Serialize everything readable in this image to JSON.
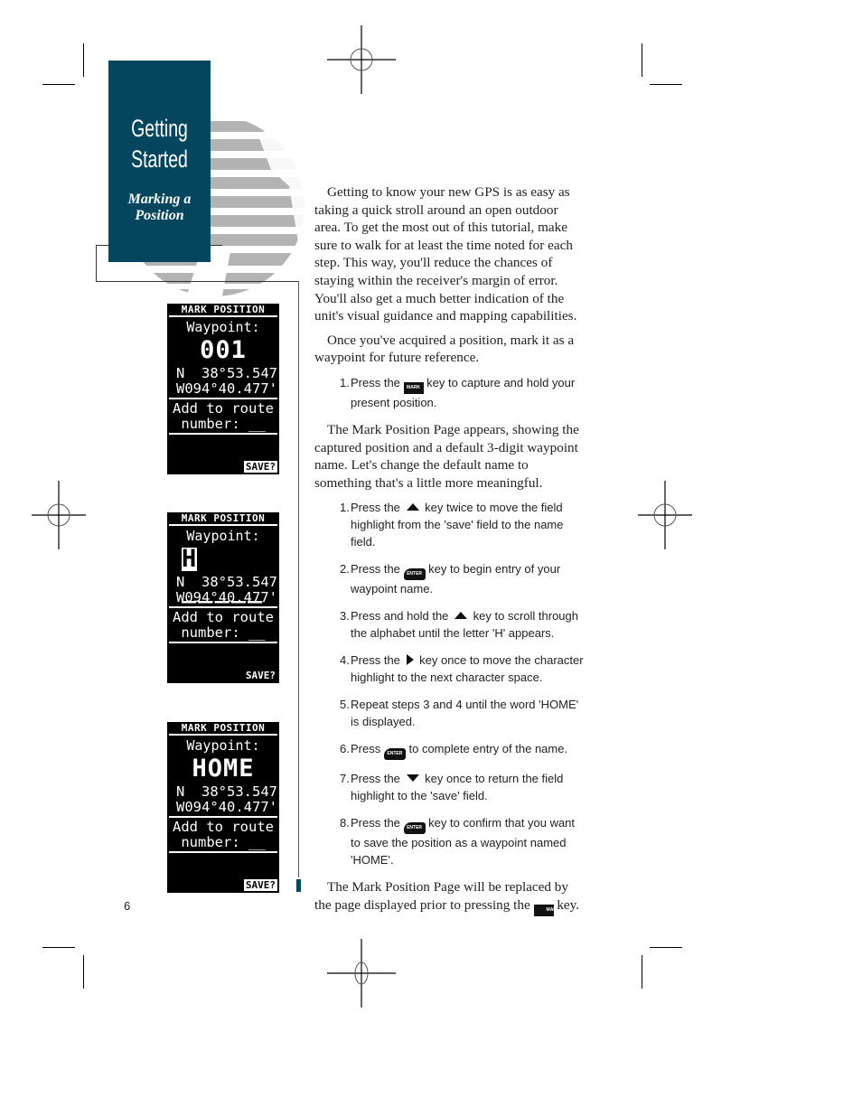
{
  "section_tab": {
    "title_line1": "Getting",
    "title_line2": "Started",
    "subtitle_line1": "Marking a",
    "subtitle_line2": "Position",
    "color": "#04465e"
  },
  "screens": [
    {
      "header": "MARK POSITION",
      "label": "Waypoint:",
      "name": "001",
      "name_highlight": "",
      "name_rest": "001",
      "lat": "N  38°53.547'",
      "lon": "W094°40.477'",
      "route_line1": "Add to route",
      "route_line2": "number: __",
      "save": "SAVE?",
      "save_highlighted": true
    },
    {
      "header": "MARK POSITION",
      "label": "Waypoint:",
      "name": "H_____",
      "name_highlight": "H",
      "name_rest": "_____",
      "lat": "N  38°53.547'",
      "lon": "W094°40.477'",
      "route_line1": "Add to route",
      "route_line2": "number: __",
      "save": "SAVE?",
      "save_highlighted": false
    },
    {
      "header": "MARK POSITION",
      "label": "Waypoint:",
      "name": "HOME",
      "name_highlight": "",
      "name_rest": "HOME",
      "lat": "N  38°53.547'",
      "lon": "W094°40.477'",
      "route_line1": "Add to route",
      "route_line2": "number: __",
      "save": "SAVE?",
      "save_highlighted": true
    }
  ],
  "body": {
    "intro": "Getting to know your new GPS is as easy as taking a quick stroll around an open outdoor area. To get the most out of this tutorial, make sure to walk for at least the time noted for each step. This way, you'll reduce the chances of staying within the receiver's margin of error. You'll also get a much better indication of the unit's visual guidance and mapping capabilities.",
    "para2": "Once you've acquired a position, mark it as a waypoint for future reference.",
    "step_a": {
      "num": "1.",
      "pre": "Press the",
      "key": "MARK",
      "post": "key to capture and hold your present position."
    },
    "para3": "The Mark Position Page appears, showing the captured position and a default 3-digit waypoint name. Let's change the default name to something that's a little more meaningful.",
    "steps": [
      {
        "num": "1.",
        "pre": "Press the",
        "key": "up-arrow",
        "post": "key twice to move the field highlight from the 'save' field to the name field."
      },
      {
        "num": "2.",
        "pre": "Press the",
        "key": "ENTER",
        "post": "key to begin entry of your waypoint name."
      },
      {
        "num": "3.",
        "pre": "Press and hold the",
        "key": "up-arrow",
        "post": "key to scroll through the alphabet until the letter 'H' appears."
      },
      {
        "num": "4.",
        "pre": "Press the",
        "key": "right-arrow",
        "post": "key once to move the character highlight to the next character space."
      },
      {
        "num": "5.",
        "pre": "Repeat steps 3 and 4 until the word 'HOME' is displayed.",
        "key": "",
        "post": ""
      },
      {
        "num": "6.",
        "pre": "Press",
        "key": "ENTER",
        "post": "to complete entry of the name."
      },
      {
        "num": "7.",
        "pre": "Press the",
        "key": "down-arrow",
        "post": "key once to return the field highlight to the 'save' field."
      },
      {
        "num": "8.",
        "pre": "Press the",
        "key": "ENTER",
        "post": "key to confirm that you want to save the position as a waypoint named 'HOME'."
      }
    ],
    "closing_pre": "The Mark Position Page will be replaced by the page displayed prior to pressing the",
    "closing_key": "MARK",
    "closing_post": "key."
  },
  "page_number": "6"
}
